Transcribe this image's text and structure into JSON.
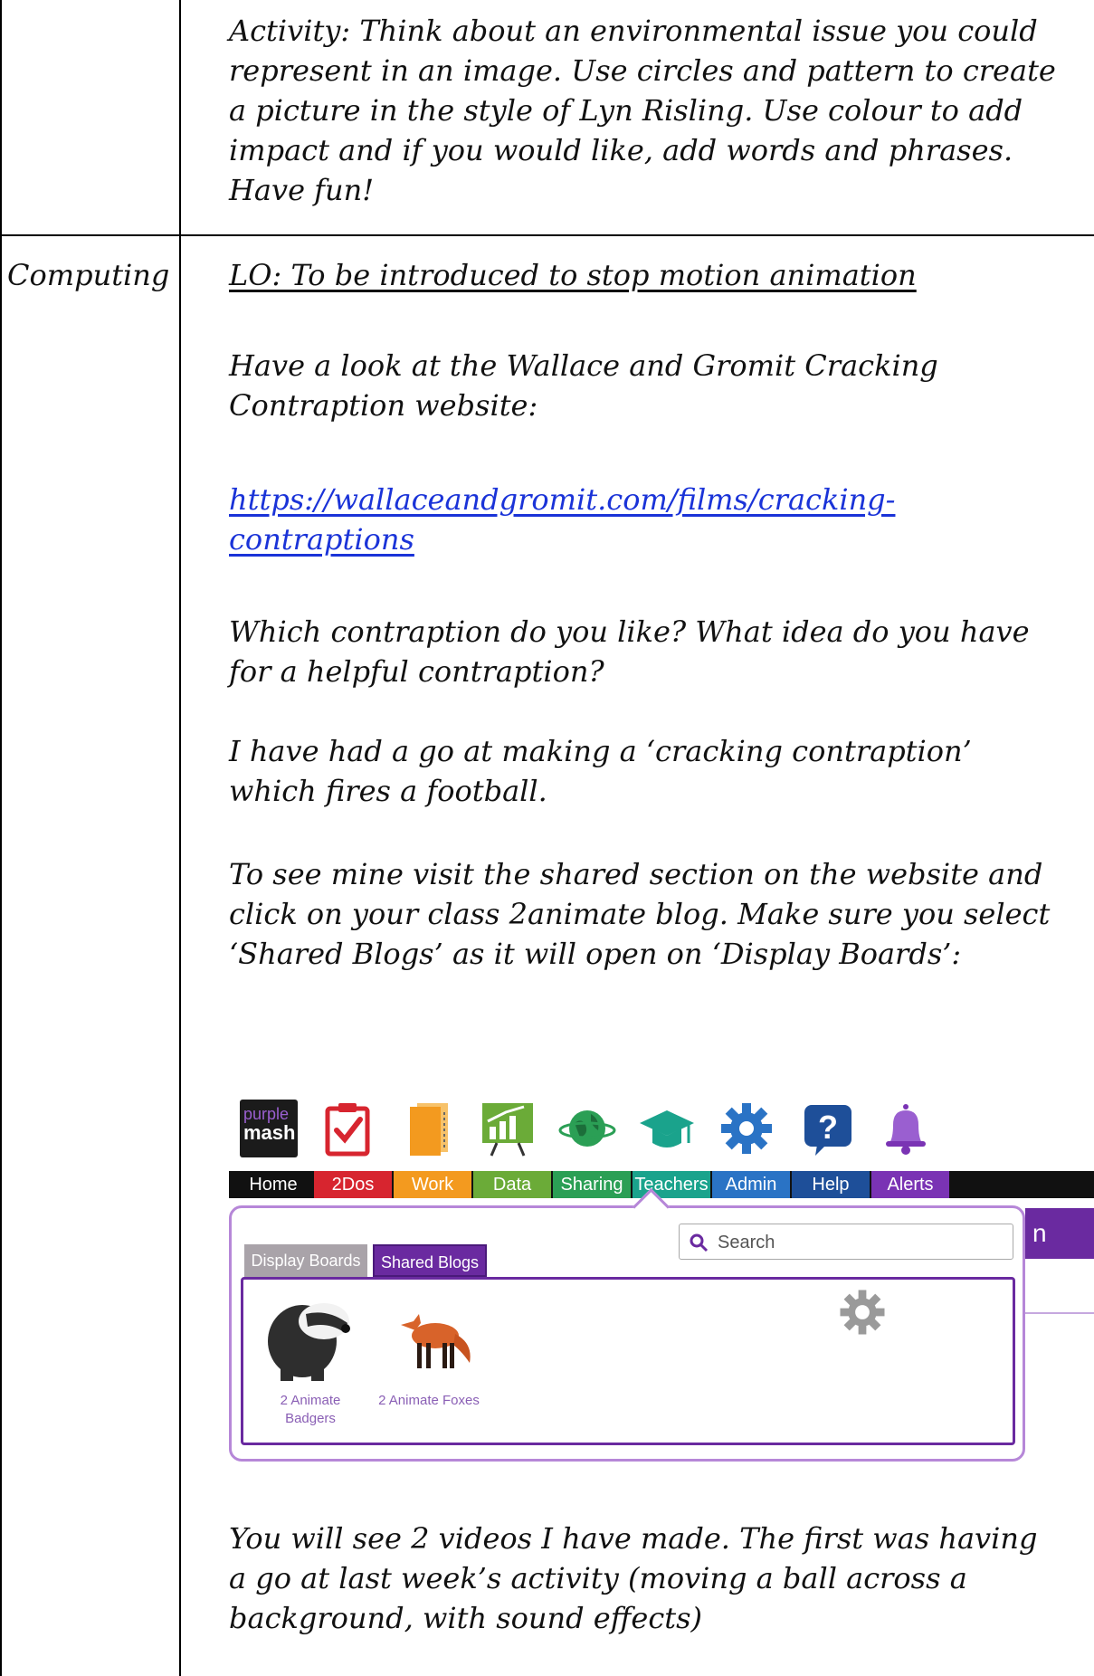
{
  "table": {
    "subject_label": "Computing"
  },
  "art": {
    "activity": "Activity: Think about an environmental issue you could represent in an image. Use circles and pattern to create a picture in the style of Lyn Risling. Use colour to add impact and if you would like, add words and phrases. Have fun!"
  },
  "computing": {
    "lo": "LO: To be introduced to stop motion animation",
    "p1": "Have a look at the Wallace and Gromit Cracking Contraption website:",
    "link": "https://wallaceandgromit.com/films/cracking-contraptions",
    "p2": "Which contraption do you like? What idea do you have for a helpful contraption?",
    "p3": "I have had a go at making a ‘cracking contraption’ which fires a football.",
    "p4": "To see mine visit the shared section on the website and click on your class 2animate blog. Make sure you select ‘Shared Blogs’ as it will open on ‘Display Boards’:",
    "p5": "You will see 2 videos I have made. The first was having a go at last week’s activity (moving a ball across a background, with sound effects)"
  },
  "purple_mash": {
    "logo_line1": "purple",
    "logo_line2": "mash",
    "nav": [
      {
        "label": "Home",
        "color": "#111111",
        "icon": "home-logo"
      },
      {
        "label": "2Dos",
        "color": "#d7252f",
        "icon": "clipboard-check-icon"
      },
      {
        "label": "Work",
        "color": "#f39a1f",
        "icon": "folder-icon"
      },
      {
        "label": "Data",
        "color": "#6bab38",
        "icon": "chart-icon"
      },
      {
        "label": "Sharing",
        "color": "#2b9f55",
        "icon": "globe-icon"
      },
      {
        "label": "Teachers",
        "color": "#1aa38c",
        "icon": "graduation-cap-icon"
      },
      {
        "label": "Admin",
        "color": "#2a73c5",
        "icon": "gear-icon"
      },
      {
        "label": "Help",
        "color": "#1e4f99",
        "icon": "help-icon"
      },
      {
        "label": "Alerts",
        "color": "#7a33b4",
        "icon": "bell-icon"
      }
    ],
    "tabs": {
      "display_boards": "Display Boards",
      "shared_blogs": "Shared Blogs"
    },
    "search_placeholder": "Search",
    "right_band_text": "n",
    "blogs": [
      {
        "caption": "2 Animate Badgers",
        "icon": "badger-image"
      },
      {
        "caption": "2 Animate Foxes",
        "icon": "fox-image"
      }
    ],
    "colors": {
      "purple": "#6a2aa0",
      "light_purple": "#b687d8"
    }
  }
}
